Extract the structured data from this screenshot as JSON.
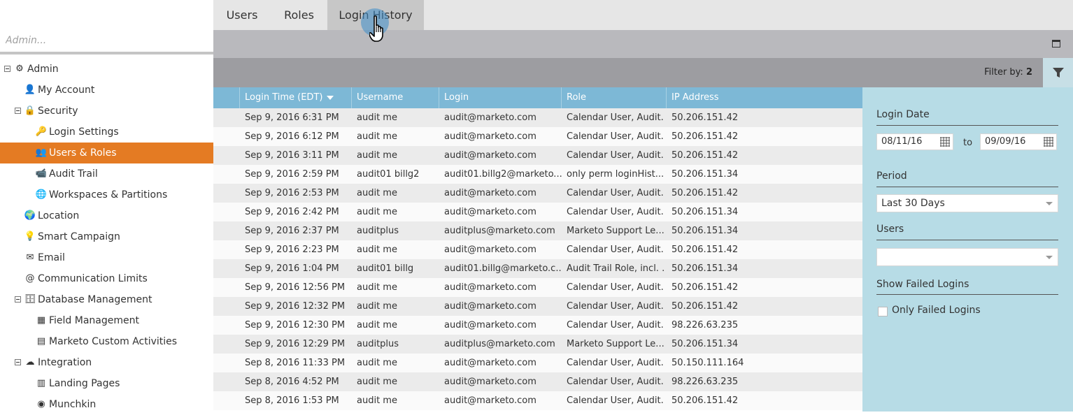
{
  "tabs": [
    {
      "label": "Users",
      "active": false
    },
    {
      "label": "Roles",
      "active": false
    },
    {
      "label": "Login History",
      "active": true
    }
  ],
  "search": {
    "placeholder": "Admin..."
  },
  "sidebar": {
    "items": [
      {
        "label": "Admin",
        "icon": "gear-icon",
        "level": 0,
        "expandable": true
      },
      {
        "label": "My Account",
        "icon": "user-icon",
        "level": 1
      },
      {
        "label": "Security",
        "icon": "lock-icon",
        "level": 1,
        "expandable": true
      },
      {
        "label": "Login Settings",
        "icon": "key-icon",
        "level": 2
      },
      {
        "label": "Users & Roles",
        "icon": "users-icon",
        "level": 2,
        "selected": true
      },
      {
        "label": "Audit Trail",
        "icon": "camera-icon",
        "level": 2
      },
      {
        "label": "Workspaces & Partitions",
        "icon": "globe-icon",
        "level": 2
      },
      {
        "label": "Location",
        "icon": "earth-icon",
        "level": 1
      },
      {
        "label": "Smart Campaign",
        "icon": "lightbulb-icon",
        "level": 1
      },
      {
        "label": "Email",
        "icon": "email-icon",
        "level": 1
      },
      {
        "label": "Communication Limits",
        "icon": "at-icon",
        "level": 1
      },
      {
        "label": "Database Management",
        "icon": "database-icon",
        "level": 1,
        "expandable": true
      },
      {
        "label": "Field Management",
        "icon": "field-icon",
        "level": 2
      },
      {
        "label": "Marketo Custom Activities",
        "icon": "activity-icon",
        "level": 2
      },
      {
        "label": "Integration",
        "icon": "cloud-icon",
        "level": 1,
        "expandable": true
      },
      {
        "label": "Landing Pages",
        "icon": "page-icon",
        "level": 2
      },
      {
        "label": "Munchkin",
        "icon": "munchkin-icon",
        "level": 2
      }
    ]
  },
  "filterbar": {
    "label": "Filter by:",
    "count": "2"
  },
  "grid": {
    "columns": [
      "Login Time (EDT)",
      "Username",
      "Login",
      "Role",
      "IP Address"
    ],
    "rows": [
      [
        "Sep 9, 2016 6:31 PM",
        "audit me",
        "audit@marketo.com",
        "Calendar User, Audit...",
        "50.206.151.42"
      ],
      [
        "Sep 9, 2016 6:12 PM",
        "audit me",
        "audit@marketo.com",
        "Calendar User, Audit...",
        "50.206.151.42"
      ],
      [
        "Sep 9, 2016 3:11 PM",
        "audit me",
        "audit@marketo.com",
        "Calendar User, Audit...",
        "50.206.151.42"
      ],
      [
        "Sep 9, 2016 2:59 PM",
        "audit01 billg2",
        "audit01.billg2@marketo....",
        "only perm loginHist...",
        "50.206.151.34"
      ],
      [
        "Sep 9, 2016 2:53 PM",
        "audit me",
        "audit@marketo.com",
        "Calendar User, Audit...",
        "50.206.151.42"
      ],
      [
        "Sep 9, 2016 2:42 PM",
        "audit me",
        "audit@marketo.com",
        "Calendar User, Audit...",
        "50.206.151.34"
      ],
      [
        "Sep 9, 2016 2:37 PM",
        "auditplus",
        "auditplus@marketo.com",
        "Marketo Support Le...",
        "50.206.151.34"
      ],
      [
        "Sep 9, 2016 2:23 PM",
        "audit me",
        "audit@marketo.com",
        "Calendar User, Audit...",
        "50.206.151.42"
      ],
      [
        "Sep 9, 2016 1:04 PM",
        "audit01 billg",
        "audit01.billg@marketo.c...",
        "Audit Trail Role, incl. ...",
        "50.206.151.34"
      ],
      [
        "Sep 9, 2016 12:56 PM",
        "audit me",
        "audit@marketo.com",
        "Calendar User, Audit...",
        "50.206.151.42"
      ],
      [
        "Sep 9, 2016 12:32 PM",
        "audit me",
        "audit@marketo.com",
        "Calendar User, Audit...",
        "50.206.151.42"
      ],
      [
        "Sep 9, 2016 12:30 PM",
        "audit me",
        "audit@marketo.com",
        "Calendar User, Audit...",
        "98.226.63.235"
      ],
      [
        "Sep 9, 2016 12:29 PM",
        "auditplus",
        "auditplus@marketo.com",
        "Marketo Support Le...",
        "50.206.151.34"
      ],
      [
        "Sep 8, 2016 11:33 PM",
        "audit me",
        "audit@marketo.com",
        "Calendar User, Audit...",
        "50.150.111.164"
      ],
      [
        "Sep 8, 2016 4:52 PM",
        "audit me",
        "audit@marketo.com",
        "Calendar User, Audit...",
        "98.226.63.235"
      ],
      [
        "Sep 8, 2016 1:53 PM",
        "audit me",
        "audit@marketo.com",
        "Calendar User, Audit...",
        "50.206.151.42"
      ]
    ]
  },
  "panel": {
    "login_date_label": "Login Date",
    "date_from": "08/11/16",
    "to_label": "to",
    "date_to": "09/09/16",
    "period_label": "Period",
    "period_value": "Last 30 Days",
    "users_label": "Users",
    "users_value": "",
    "failed_label": "Show Failed Logins",
    "only_failed_label": "Only Failed Logins"
  },
  "colors": {
    "accent": "#e47b23",
    "grid_header": "#7db8d6",
    "panel_bg": "#b7dce6"
  }
}
